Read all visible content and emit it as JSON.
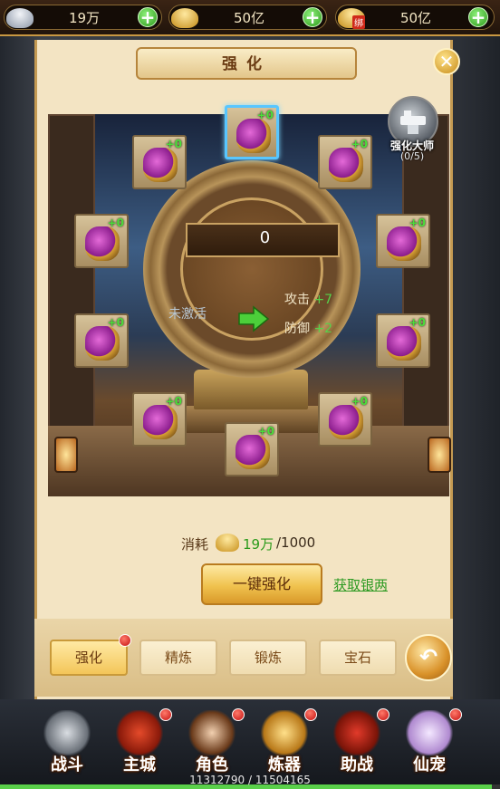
{
  "topbar": {
    "silver": {
      "value": "19万",
      "icon": "silver-ingot-icon"
    },
    "gold": {
      "value": "50亿",
      "icon": "gold-ingot-icon"
    },
    "bound_gold": {
      "value": "50亿",
      "icon": "bound-gold-ingot-icon",
      "tag": "绑"
    },
    "add_glyph": "+"
  },
  "panel": {
    "title": "强化",
    "close_glyph": "✕"
  },
  "forge": {
    "power": "0",
    "status_text": "未激活",
    "attack_label": "攻击",
    "attack_bonus": "+7",
    "defense_label": "防御",
    "defense_bonus": "+2",
    "master_label": "强化大师",
    "master_count": "(0/5)",
    "slots": [
      {
        "name": "weapon",
        "level": "+0",
        "selected": true
      },
      {
        "name": "boots",
        "level": "+0"
      },
      {
        "name": "helmet",
        "level": "+0"
      },
      {
        "name": "armor",
        "level": "+0"
      },
      {
        "name": "necklace",
        "level": "+0"
      },
      {
        "name": "belt",
        "level": "+0"
      },
      {
        "name": "shoulder",
        "level": "+0"
      },
      {
        "name": "gloves",
        "level": "+0"
      },
      {
        "name": "crown",
        "level": "+0"
      },
      {
        "name": "ring",
        "level": "+0"
      }
    ]
  },
  "cost": {
    "label": "消耗",
    "have": "19万",
    "need": "/1000"
  },
  "actions": {
    "one_key_enhance": "一键强化",
    "get_silver": "获取银两"
  },
  "tabs": [
    {
      "label": "强化",
      "active": true,
      "badge": true
    },
    {
      "label": "精炼"
    },
    {
      "label": "锻炼"
    },
    {
      "label": "宝石"
    }
  ],
  "nav": [
    {
      "label": "战斗",
      "icon": "crossed-swords-icon",
      "badge": false
    },
    {
      "label": "主城",
      "icon": "city-gate-icon",
      "badge": true
    },
    {
      "label": "角色",
      "icon": "character-portrait-icon",
      "badge": true
    },
    {
      "label": "炼器",
      "icon": "forge-box-icon",
      "badge": true
    },
    {
      "label": "助战",
      "icon": "war-drum-icon",
      "badge": true
    },
    {
      "label": "仙宠",
      "icon": "spirit-pet-icon",
      "badge": true
    }
  ],
  "experience": {
    "text": "11312790 / 11504165",
    "fraction": 0.9834
  },
  "colors": {
    "accent_gold": "#f0c24e",
    "bonus_green": "#56d24a",
    "badge_red": "#c41010"
  }
}
